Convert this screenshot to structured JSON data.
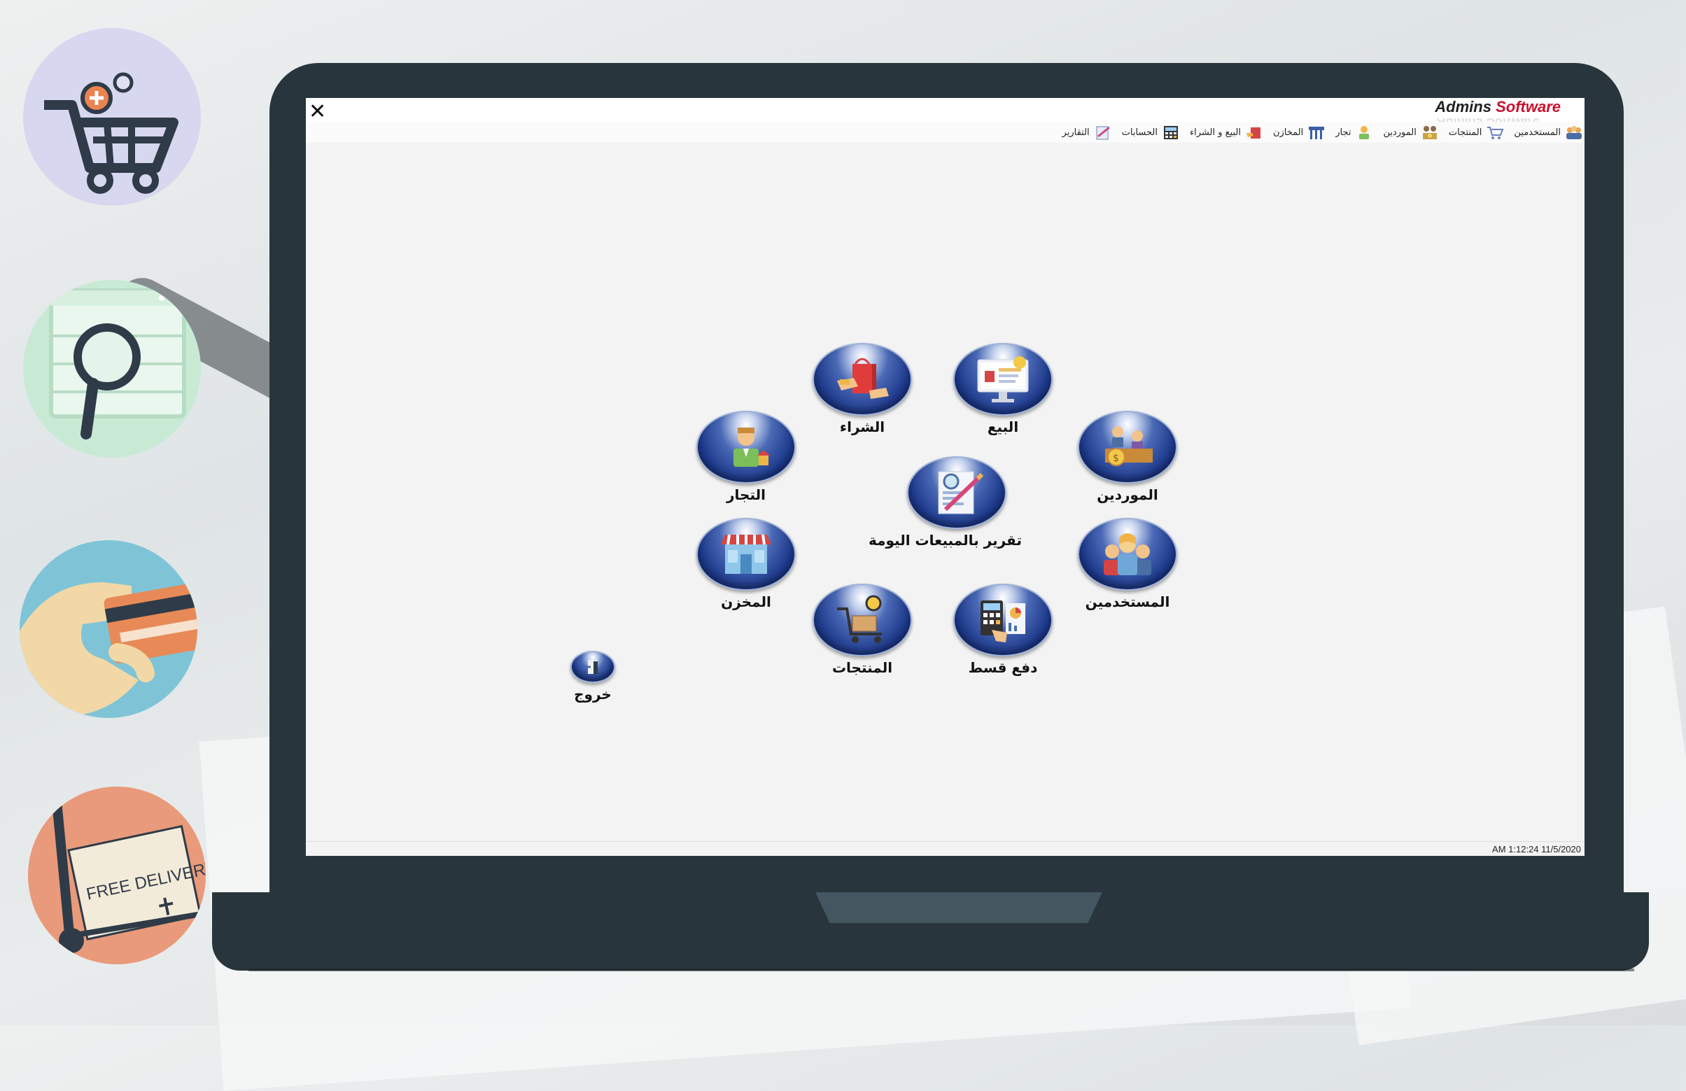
{
  "app": {
    "brand_prefix": "Admins",
    "brand_suffix": "Software",
    "brand_reflection": "Admins Software",
    "close_glyph": "✕",
    "accent": "#c8102e"
  },
  "menu": [
    {
      "label": "المستخدمين",
      "icon": "users-icon"
    },
    {
      "label": "المنتجات",
      "icon": "products-cart-icon"
    },
    {
      "label": "الموردين",
      "icon": "suppliers-icon"
    },
    {
      "label": "تجار",
      "icon": "merchant-icon"
    },
    {
      "label": "المخازن",
      "icon": "store-icon"
    },
    {
      "label": "البيع و الشراء",
      "icon": "buy-sell-icon"
    },
    {
      "label": "الحسابات",
      "icon": "accounts-icon"
    },
    {
      "label": "التقارير",
      "icon": "reports-icon"
    }
  ],
  "hubs": {
    "sale": {
      "label": "البيع",
      "icon": "sales-screen-icon"
    },
    "purchase": {
      "label": "الشراء",
      "icon": "purchase-bag-icon"
    },
    "merchants": {
      "label": "التجار",
      "icon": "merchant-person-icon"
    },
    "suppliers": {
      "label": "الموردين",
      "icon": "suppliers-money-icon"
    },
    "daily_report": {
      "label": "تقرير بالمبيعات اليومة",
      "icon": "report-document-icon"
    },
    "warehouse": {
      "label": "المخزن",
      "icon": "storefront-icon"
    },
    "users": {
      "label": "المستخدمين",
      "icon": "users-group-icon"
    },
    "products": {
      "label": "المنتجات",
      "icon": "cart-box-icon"
    },
    "installment": {
      "label": "دفع قسط",
      "icon": "calculator-chart-icon"
    },
    "exit": {
      "label": "خروج",
      "icon": "exit-door-icon"
    }
  },
  "status": {
    "datetime": "AM 1:12:24 11/5/2020"
  },
  "decorations": [
    {
      "name": "shopping-cart-icon",
      "bg": "#d7d8ef"
    },
    {
      "name": "magnifier-browser-icon",
      "bg": "#c8ead5"
    },
    {
      "name": "credit-card-hand-icon",
      "bg": "#7ec4d6"
    },
    {
      "name": "free-delivery-icon",
      "text": "FREE DELIVERY",
      "bg": "#e89a7a"
    }
  ]
}
